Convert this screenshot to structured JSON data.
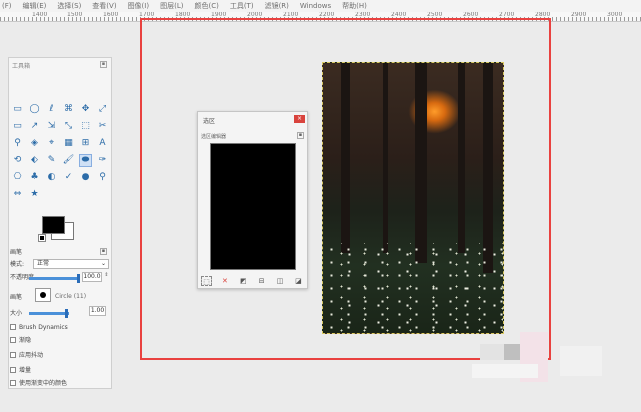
{
  "menu": [
    "(F)",
    "编辑(E)",
    "选择(S)",
    "查看(V)",
    "图像(I)",
    "图层(L)",
    "颜色(C)",
    "工具(T)",
    "滤镜(R)",
    "Windows",
    "帮助(H)"
  ],
  "ruler_labels": [
    "1400",
    "1500",
    "1600",
    "1700",
    "1800",
    "1900",
    "2000",
    "2100",
    "2200",
    "2300",
    "2400",
    "2500",
    "2600",
    "2700",
    "2800",
    "2900",
    "3000"
  ],
  "toolbox": {
    "title": "工具箱",
    "tools": [
      "▭",
      "◯",
      "ℓ",
      "⌘",
      "✥",
      "⤢",
      "▭",
      "↗",
      "⇲",
      "⤡",
      "⬚",
      "✂",
      "⚲",
      "◈",
      "⌖",
      "▦",
      "⊞",
      "A",
      "⟲",
      "⬖",
      "✎",
      "🖌",
      "⬬",
      "✑",
      "⎔",
      "♣",
      "◐",
      "✓",
      "●",
      "⚲",
      "⇔",
      "★"
    ],
    "selected_tool_index": 22,
    "options": {
      "section_label": "画笔",
      "mode_label": "模式:",
      "mode_value": "正常",
      "opacity_label": "不透明度",
      "opacity_value": "100.0",
      "brush_label": "画笔",
      "brush_name": "Circle (11)",
      "size_label": "大小",
      "size_value": "1.00",
      "dynamics_label": "Brush Dynamics",
      "checkboxes": [
        "渐隐",
        "应用抖动",
        "增量",
        "使用渐变中的颜色"
      ]
    }
  },
  "dialog": {
    "title": "选区",
    "subtitle": "选区编辑器",
    "close": "×",
    "tools": [
      "⬚",
      "✕",
      "◩",
      "⊟",
      "◫",
      "◪"
    ]
  },
  "colors": {
    "accent_frame": "#e9413f",
    "dialog_close": "#d9433d",
    "foreground": "#000000",
    "background": "#ffffff"
  }
}
